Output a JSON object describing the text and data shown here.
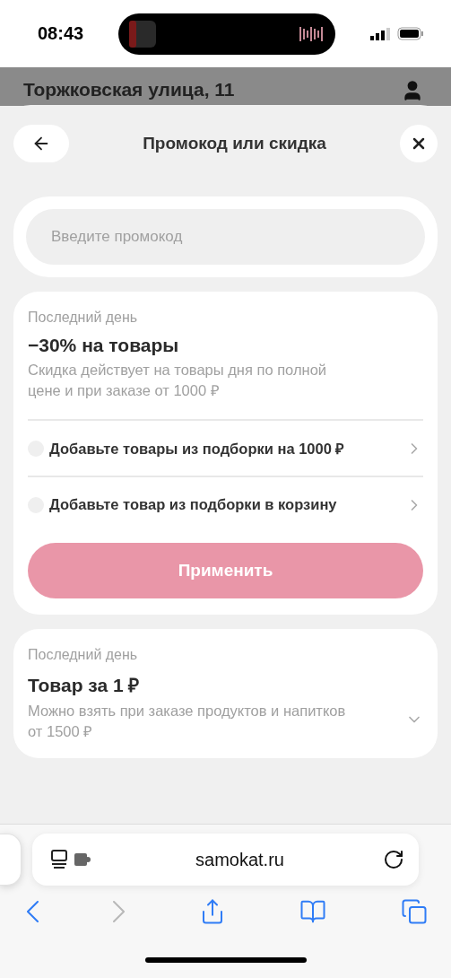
{
  "status_bar": {
    "time": "08:43"
  },
  "page_behind": {
    "address": "Торжковская улица, 11"
  },
  "sheet": {
    "title": "Промокод или скидка"
  },
  "promo_field": {
    "placeholder": "Введите промокод"
  },
  "offers": [
    {
      "tag": "Последний день",
      "title": "−30% на товары",
      "description": "Скидка действует на товары дня по полной цене и при заказе от 1000 ₽",
      "expanded": true,
      "conditions": [
        {
          "label": "Добавьте товары из подборки на 1000 ₽",
          "done": false
        },
        {
          "label": "Добавьте товар из подборки в корзину",
          "done": false
        }
      ],
      "apply_button": {
        "label": "Применить",
        "disabled": true
      }
    },
    {
      "tag": "Последний день",
      "title": "Товар за 1 ₽",
      "description": "Можно взять при заказе продуктов и напитков от 1500 ₽",
      "expanded": false
    }
  ],
  "browser": {
    "url": "samokat.ru",
    "back_disabled": false,
    "forward_disabled": true
  }
}
